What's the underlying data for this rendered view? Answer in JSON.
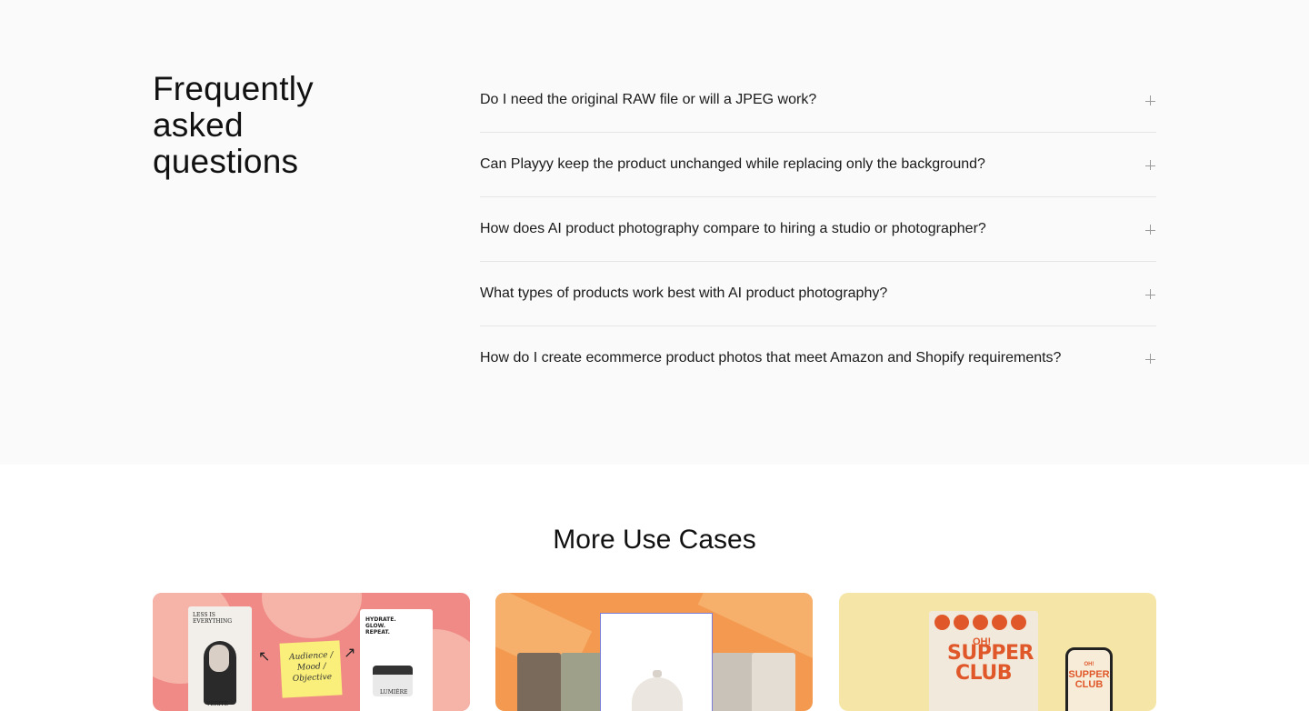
{
  "faq": {
    "title": "Frequently asked questions",
    "items": [
      {
        "question": "Do I need the original RAW file or will a JPEG work?",
        "icon": "plus-icon"
      },
      {
        "question": "Can Playyy keep the product unchanged while replacing only the background?",
        "icon": "plus-icon"
      },
      {
        "question": "How does AI product photography compare to hiring a studio or photographer?",
        "icon": "plus-icon"
      },
      {
        "question": "What types of products work best with AI product photography?",
        "icon": "plus-icon"
      },
      {
        "question": "How do I create ecommerce product photos that meet Amazon and Shopify requirements?",
        "icon": "plus-icon"
      }
    ]
  },
  "more_use_cases": {
    "title": "More Use Cases",
    "cards": [
      {
        "accent": "#f08a86",
        "portrait_caption": "LESS IS EVERYTHING",
        "portrait_brand": "VÉRITÉ",
        "note": "Audience / Mood / Objective",
        "product_caption": "HYDRATE. GLOW. REPEAT.",
        "product_brand": "LUMIÈRE"
      },
      {
        "accent": "#f39a50"
      },
      {
        "accent": "#f5e6a8",
        "poster_kicker": "OH!",
        "poster_title": "SUPPER CLUB",
        "phone_kicker": "OH!",
        "phone_title": "SUPPER CLUB"
      }
    ]
  },
  "colors": {
    "faq_background": "#fafafa",
    "divider": "#e6e6e6",
    "text": "#111111",
    "icon": "#9a9a9a"
  }
}
